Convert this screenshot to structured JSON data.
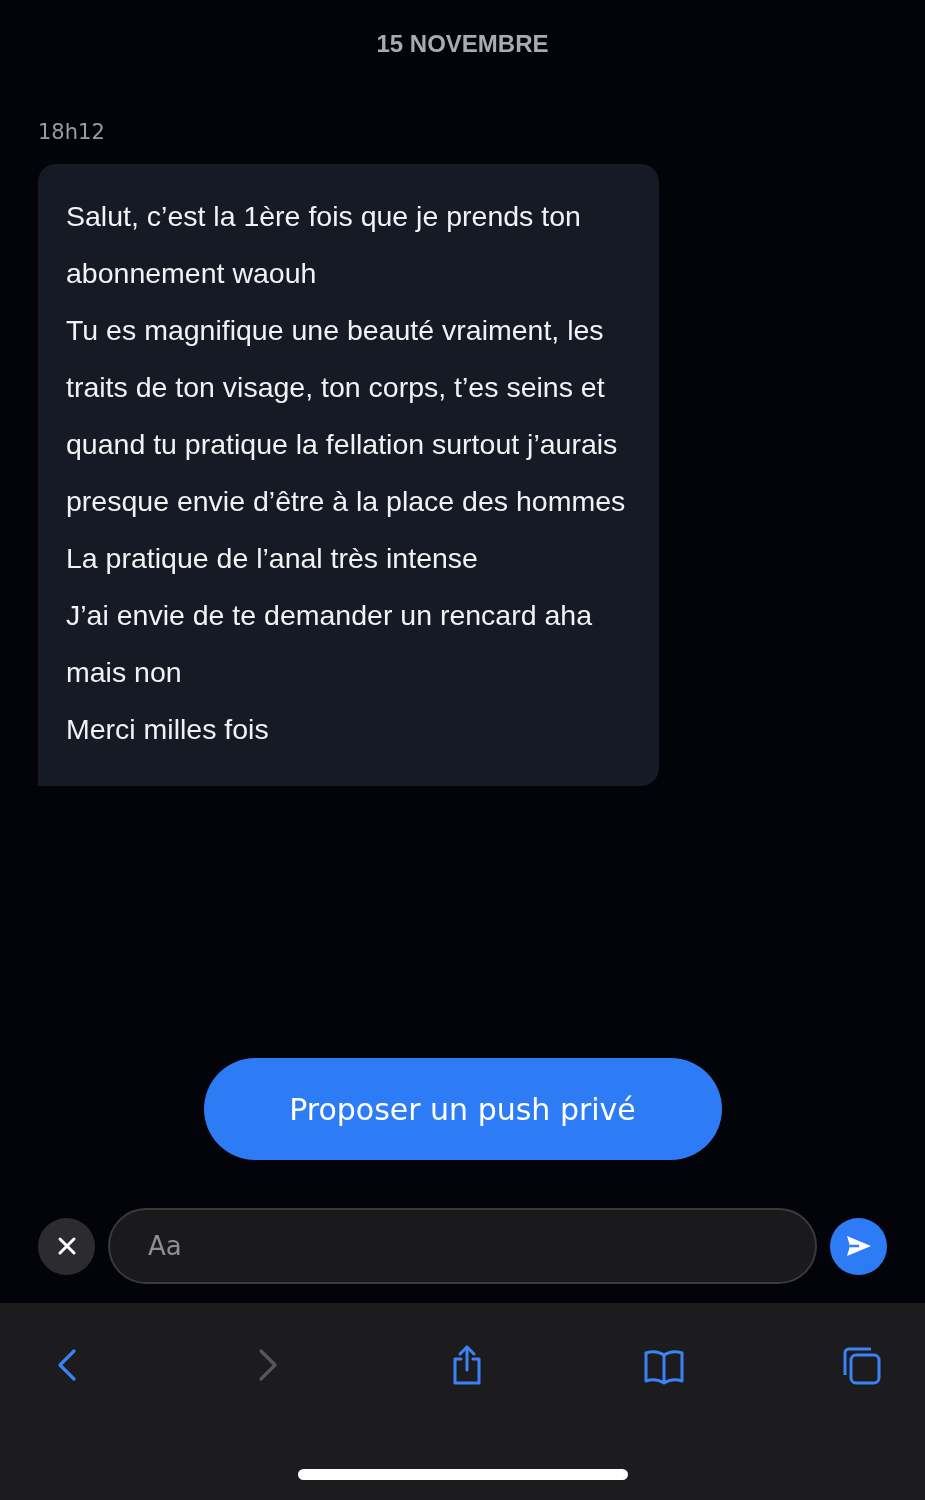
{
  "date_header": "15 NOVEMBRE",
  "message": {
    "time": "18h12",
    "paragraphs": [
      "Salut, c’est la 1ère fois que je prends ton abonnement waouh",
      "Tu es magnifique une beauté vraiment, les traits de ton visage, ton corps, t’es seins et quand tu pratique la fellation surtout j’aurais presque envie d’être à la place des hommes",
      "La pratique de l’anal très intense",
      "J’ai envie de te demander un rencard aha mais non",
      "Merci milles fois"
    ]
  },
  "action_button": "Proposer un push privé",
  "composer": {
    "placeholder": "Aa"
  },
  "toolbar": [
    {
      "kind": "back",
      "disabled": false
    },
    {
      "kind": "forward",
      "disabled": true
    },
    {
      "kind": "share",
      "disabled": false
    },
    {
      "kind": "bookmarks",
      "disabled": false
    },
    {
      "kind": "tabs",
      "disabled": false
    }
  ]
}
